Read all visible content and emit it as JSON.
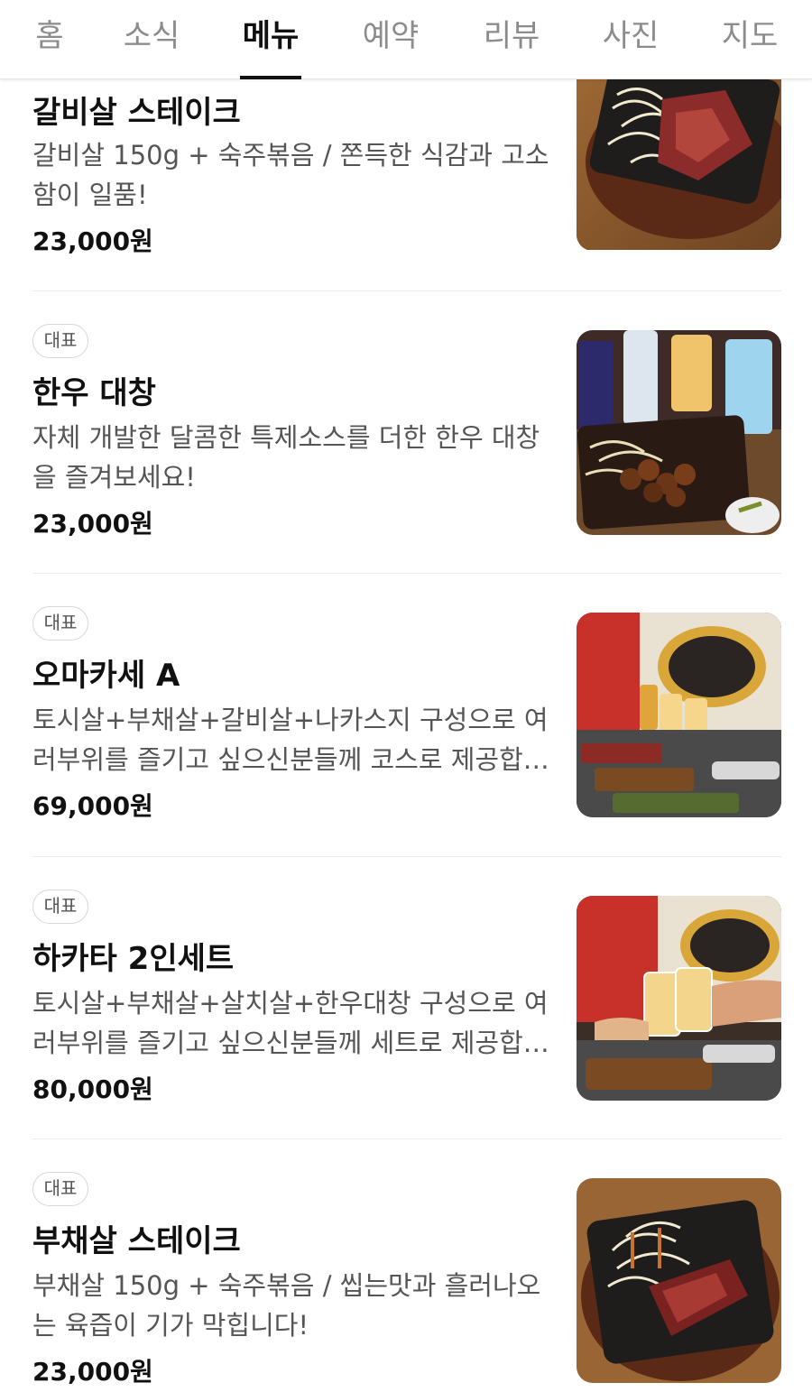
{
  "tabs": [
    {
      "label": "홈"
    },
    {
      "label": "소식"
    },
    {
      "label": "메뉴"
    },
    {
      "label": "예약"
    },
    {
      "label": "리뷰"
    },
    {
      "label": "사진"
    },
    {
      "label": "지도"
    }
  ],
  "active_tab": "메뉴",
  "menu": [
    {
      "name": "갈비살 스테이크",
      "description": "갈비살 150g + 숙주볶음 / 쫀득한 식감과 고소함이 일품!",
      "price": "23,000원",
      "photo": "steak-on-iron-plate-photo"
    },
    {
      "badge": "대표",
      "name": "한우 대창",
      "description": "자체 개발한 달콤한 특제소스를 더한 한우 대창을 즐겨보세요!",
      "price": "23,000원",
      "photo": "daechang-with-drinks-photo"
    },
    {
      "badge": "대표",
      "name": "오마카세 A",
      "description": "토시살+부채살+갈비살+나카스지 구성으로 여러부위를 즐기고 싶으신분들께 코스로 제공합니다",
      "price": "69,000원",
      "photo": "omakase-counter-photo"
    },
    {
      "badge": "대표",
      "name": "하카타 2인세트",
      "description": "토시살+부채살+살치살+한우대창 구성으로 여러부위를 즐기고 싶으신분들께 세트로 제공합니다",
      "price": "80,000원",
      "photo": "highball-cheers-photo"
    },
    {
      "badge": "대표",
      "name": "부채살 스테이크",
      "description": "부채살 150g + 숙주볶음 / 씹는맛과 흘러나오는 육즙이 기가 막힙니다!",
      "price": "23,000원",
      "photo": "flat-iron-steak-photo"
    }
  ]
}
